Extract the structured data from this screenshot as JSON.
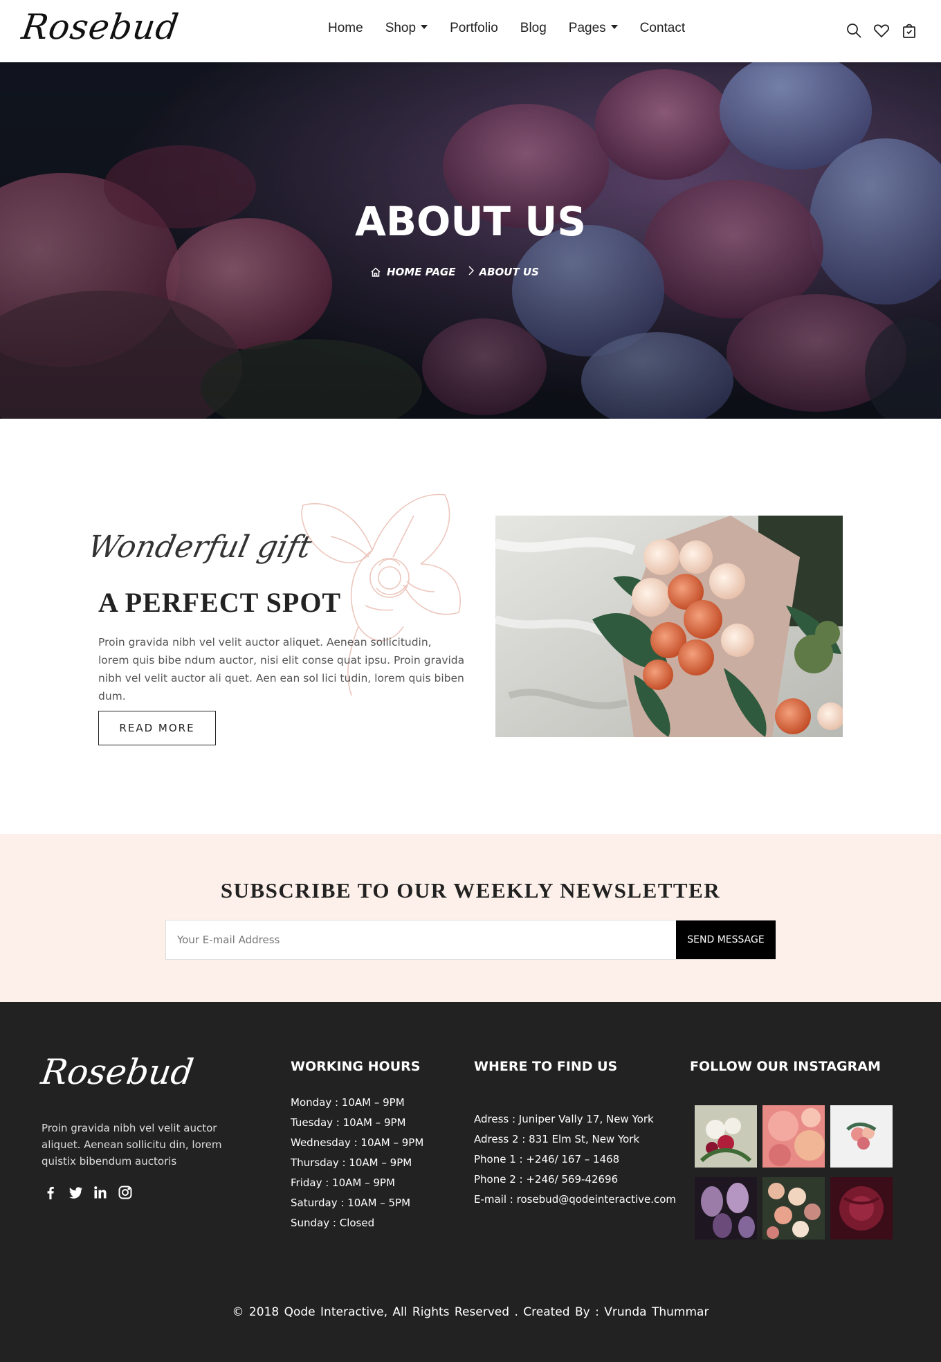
{
  "brand": {
    "logo_text": "Rosebud"
  },
  "nav": {
    "items": [
      {
        "label": "Home",
        "has_caret": false
      },
      {
        "label": "Shop",
        "has_caret": true
      },
      {
        "label": "Portfolio",
        "has_caret": false
      },
      {
        "label": "Blog",
        "has_caret": false
      },
      {
        "label": "Pages",
        "has_caret": true
      },
      {
        "label": "Contact",
        "has_caret": false
      }
    ],
    "icons": [
      "search-icon",
      "heart-icon",
      "cart-icon"
    ]
  },
  "hero": {
    "title": "ABOUT US",
    "breadcrumb": {
      "home": "HOME PAGE",
      "current": "ABOUT US"
    }
  },
  "about": {
    "script_title": "Wonderful gift",
    "heading": "A PERFECT SPOT",
    "text": "Proin gravida nibh vel velit auctor aliquet. Aenean sollicitudin, lorem quis bibe ndum auctor, nisi elit conse quat ipsu. Proin gravida nibh vel velit auctor ali quet. Aen ean sol lici tudin, lorem quis biben dum.",
    "button": "READ MORE"
  },
  "newsletter": {
    "title": "SUBSCRIBE TO OUR WEEKLY NEWSLETTER",
    "placeholder": "Your E-mail Address",
    "button": "SEND MESSAGE"
  },
  "footer": {
    "logo_text": "Rosebud",
    "about": "Proin gravida nibh vel velit auctor aliquet. Aenean sollicitu din, lorem quistix bibendum auctoris",
    "socials": [
      "facebook-icon",
      "twitter-icon",
      "linkedin-icon",
      "instagram-icon"
    ],
    "hours": {
      "title": "WORKING HOURS",
      "lines": [
        "Monday : 10AM – 9PM",
        "Tuesday : 10AM – 9PM",
        "Wednesday : 10AM – 9PM",
        "Thursday : 10AM – 9PM",
        "Friday : 10AM – 9PM",
        "Saturday : 10AM – 5PM",
        "Sunday : Closed"
      ]
    },
    "find": {
      "title": "WHERE TO FIND US",
      "lines": [
        "Adress : Juniper Vally 17, New York",
        "Adress 2 : 831 Elm St, New York",
        "Phone 1 : +246/ 167 – 1468",
        "Phone 2 : +246/ 569-42696",
        "E-mail : rosebud@qodeinteractive.com"
      ]
    },
    "instagram": {
      "title": "FOLLOW OUR INSTAGRAM"
    },
    "copyright": "© 2018 Qode Interactive, All Rights Reserved . Created By : Vrunda Thummar"
  }
}
